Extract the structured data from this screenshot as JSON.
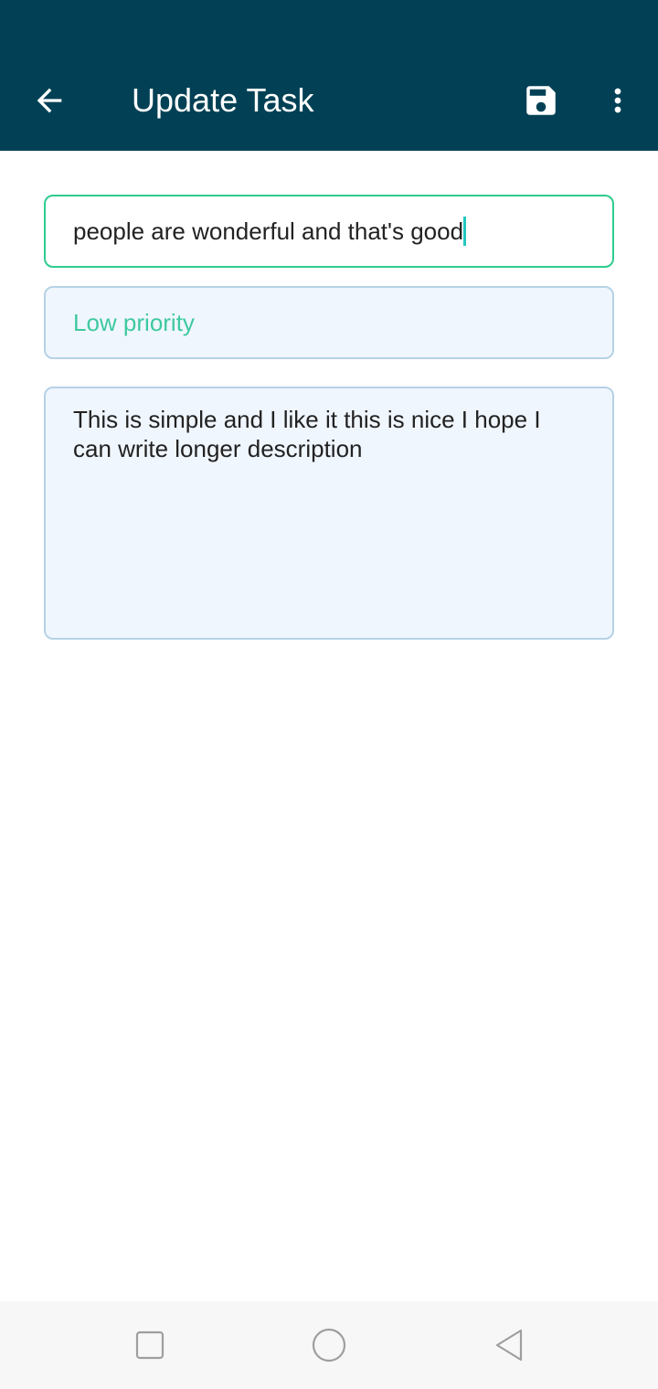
{
  "appbar": {
    "title": "Update Task",
    "background": "#024155",
    "icons": {
      "back": "arrow-back-icon",
      "save": "save-icon",
      "more": "more-vert-icon"
    }
  },
  "form": {
    "title_value": "people are wonderful and that's good",
    "priority_value": "Low priority",
    "description_value": "This is simple and I like it this is nice I hope I can write longer description",
    "colors": {
      "focus_border": "#2fcc8f",
      "priority_text": "#3ec9a0",
      "field_background": "#f0f6fd",
      "field_border": "#b6d2e6"
    }
  },
  "system_nav": {
    "icons": [
      "recents-square-icon",
      "home-circle-icon",
      "back-triangle-icon"
    ]
  }
}
